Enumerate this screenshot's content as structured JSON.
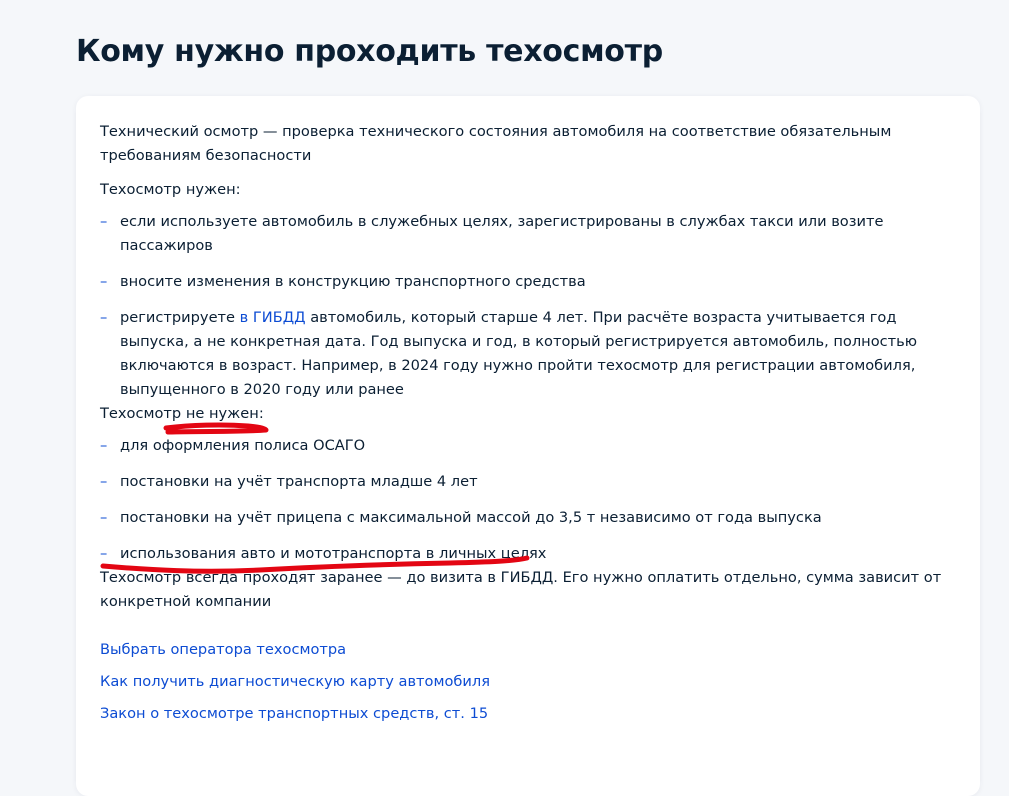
{
  "page": {
    "title": "Кому нужно проходить техосмотр"
  },
  "card": {
    "intro": "Технический осмотр — проверка технического состояния автомобиля на соответствие обязательным требованиям безопасности",
    "needed_heading": "Техосмотр нужен:",
    "needed_items": [
      {
        "text": "если используете автомобиль в служебных целях, зарегистрированы в службах такси или возите пассажиров"
      },
      {
        "text": "вносите изменения в конструкцию транспортного средства"
      },
      {
        "before": "регистрируете",
        "link": "в ГИБДД",
        "after": "автомобиль, который старше 4 лет. При расчёте возраста учитывается год выпуска, а не конкретная дата. Год выпуска и год, в который регистрируется автомобиль, полностью включаются в возраст. Например, в 2024 году нужно пройти техосмотр для регистрации автомобиля, выпущенного в 2020 году или ранее"
      }
    ],
    "not_needed_heading": "Техосмотр не нужен:",
    "not_needed_items": [
      {
        "text": "для оформления полиса ОСАГО"
      },
      {
        "text": "постановки на учёт транспорта младше 4 лет"
      },
      {
        "text": "постановки на учёт прицепа с максимальной массой до 3,5 т независимо от года выпуска"
      },
      {
        "text": "использования авто и мототранспорта в личных целях"
      }
    ],
    "footer_note": "Техосмотр всегда проходят заранее — до визита в ГИБДД. Его нужно оплатить отдельно, сумма зависит от конкретной компании",
    "links": [
      {
        "label": "Выбрать оператора техосмотра"
      },
      {
        "label": "Как получить диагностическую карту автомобиля"
      },
      {
        "label": "Закон о техосмотре транспортных средств, ст. 15"
      }
    ],
    "dash_glyph": "–"
  },
  "colors": {
    "link": "#0d4cd3",
    "text": "#0b1f33",
    "page_background": "#f5f7fa",
    "card_background": "#ffffff",
    "marker": "#e30613"
  }
}
